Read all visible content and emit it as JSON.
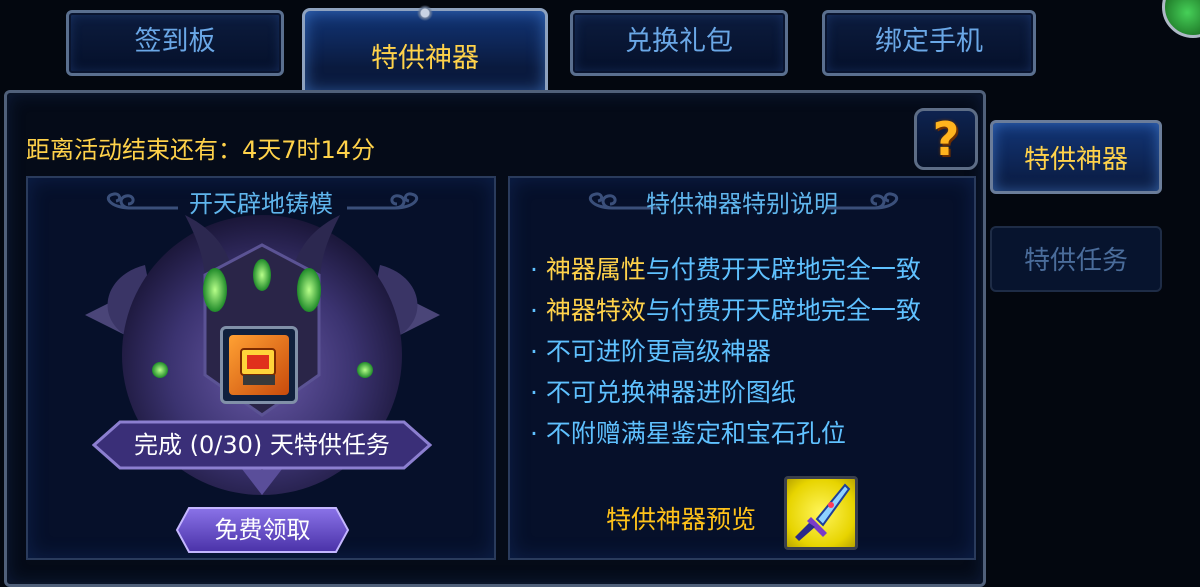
{
  "tabs": [
    {
      "label": "签到板",
      "active": false
    },
    {
      "label": "特供神器",
      "active": true
    },
    {
      "label": "兑换礼包",
      "active": false
    },
    {
      "label": "绑定手机",
      "active": false
    }
  ],
  "countdown": "距离活动结束还有：4天7时14分",
  "help_icon": "?",
  "left_panel": {
    "title": "开天辟地铸模",
    "task_text": "完成 (0/30) 天特供任务",
    "claim_button": "免费领取"
  },
  "right_panel": {
    "title": "特供神器特别说明",
    "bullets": [
      {
        "prefix": "· ",
        "highlight": "神器属性",
        "rest": "与付费开天辟地完全一致"
      },
      {
        "prefix": "· ",
        "highlight": "神器特效",
        "rest": "与付费开天辟地完全一致"
      },
      {
        "prefix": "· ",
        "highlight": "",
        "rest": "不可进阶更高级神器"
      },
      {
        "prefix": "· ",
        "highlight": "",
        "rest": "不可兑换神器进阶图纸"
      },
      {
        "prefix": "· ",
        "highlight": "",
        "rest": "不附赠满星鉴定和宝石孔位"
      }
    ],
    "preview_label": "特供神器预览"
  },
  "side_tabs": [
    {
      "label": "特供神器",
      "active": true
    },
    {
      "label": "特供任务",
      "active": false
    }
  ],
  "colors": {
    "accent_gold": "#ffd24a",
    "text_blue": "#5fc1ff",
    "frame": "#50607a",
    "background": "#050b18"
  }
}
